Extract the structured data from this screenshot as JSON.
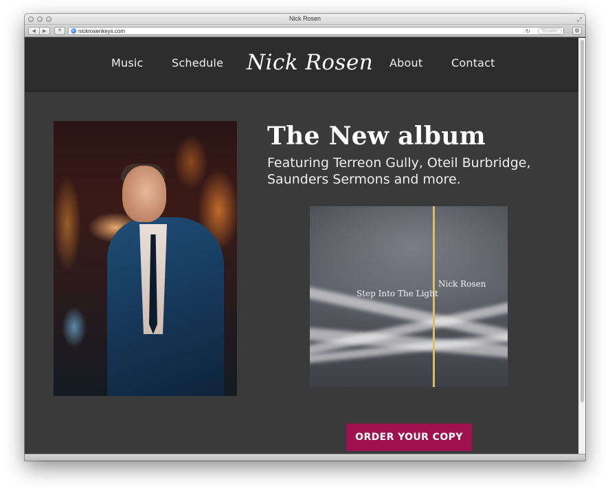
{
  "window": {
    "title": "Nick Rosen",
    "url": "nickrosenkeys.com",
    "reader_label": "Reader",
    "nav_back": "◀",
    "nav_forward": "▶",
    "add_tab": "+",
    "reload": "↻",
    "settings": "⚙",
    "fullscreen": "⤢"
  },
  "site": {
    "brand": "Nick Rosen",
    "nav": [
      "Music",
      "Schedule",
      "About",
      "Contact"
    ]
  },
  "album": {
    "heading": "The New album",
    "subheading": "Featuring Terreon Gully, Oteil Burbridge, Saunders Sermons and more.",
    "cover_title": "Step Into The Light",
    "cover_artist": "Nick Rosen",
    "cta": "ORDER YOUR COPY",
    "cta_color": "#a0114f"
  },
  "icons": {
    "globe": "globe-icon",
    "reload": "reload-icon",
    "settings": "gear-icon",
    "fullscreen": "fullscreen-icon"
  }
}
